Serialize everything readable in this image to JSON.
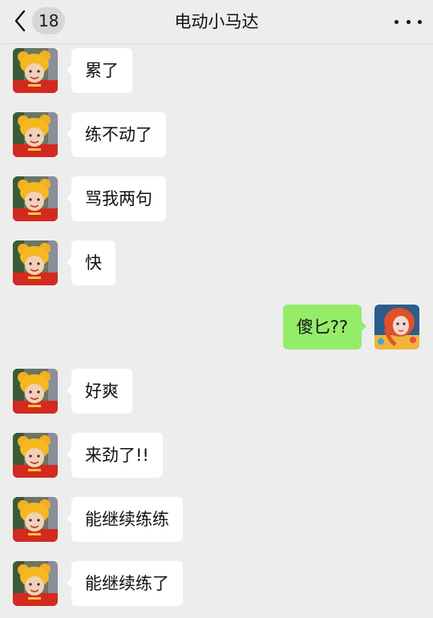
{
  "header": {
    "title": "电动小马达",
    "unread_count": "18",
    "back_icon": "chevron-left-icon",
    "more_icon": "more-horizontal-icon"
  },
  "messages": [
    {
      "side": "left",
      "text": "累了"
    },
    {
      "side": "left",
      "text": "练不动了"
    },
    {
      "side": "left",
      "text": "骂我两句"
    },
    {
      "side": "left",
      "text": "快"
    },
    {
      "side": "right",
      "text": "傻匕??"
    },
    {
      "side": "left",
      "text": "好爽"
    },
    {
      "side": "left",
      "text": "来劲了!!"
    },
    {
      "side": "left",
      "text": "能继续练练"
    },
    {
      "side": "left",
      "text": "能继续练了"
    }
  ],
  "colors": {
    "background": "#ededed",
    "incoming_bubble": "#ffffff",
    "outgoing_bubble": "#95ec69"
  }
}
